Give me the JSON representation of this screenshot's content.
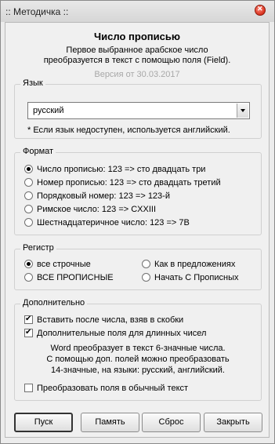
{
  "window": {
    "title": ":: Методичка ::"
  },
  "header": {
    "title": "Число прописью",
    "line1": "Первое выбранное арабское число",
    "line2": "преобразуется в текст с помощью поля (Field).",
    "version": "Версия от 30.03.2017"
  },
  "language": {
    "label": "Язык",
    "selected": "русский",
    "note": "* Если язык недоступен, используется английский."
  },
  "format": {
    "label": "Формат",
    "options": [
      {
        "label": "Число прописью: 123 => сто двадцать три",
        "selected": true
      },
      {
        "label": "Номер прописью: 123 => сто двадцать третий",
        "selected": false
      },
      {
        "label": "Порядковый номер: 123 => 123-й",
        "selected": false
      },
      {
        "label": "Римское число: 123 => CXXIII",
        "selected": false
      },
      {
        "label": "Шестнадцатеричное число: 123 => 7B",
        "selected": false
      }
    ]
  },
  "case": {
    "label": "Регистр",
    "options": [
      {
        "label": "все строчные",
        "selected": true
      },
      {
        "label": "ВСЕ ПРОПИСНЫЕ",
        "selected": false
      },
      {
        "label": "Как в предложениях",
        "selected": false
      },
      {
        "label": "Начать С Прописных",
        "selected": false
      }
    ]
  },
  "extra": {
    "label": "Дополнительно",
    "wrap_brackets": {
      "label": "Вставить после числа, взяв в скобки",
      "checked": true
    },
    "extra_fields": {
      "label": "Дополнительные поля для длинных чисел",
      "checked": true
    },
    "info_lines": [
      "Word преобразует в текст 6-значные числа.",
      "С помощью доп. полей можно преобразовать",
      "14-значные, на языки: русский, английский."
    ],
    "convert_fields": {
      "label": "Преобразовать поля в обычный текст",
      "checked": false
    }
  },
  "buttons": {
    "start": "Пуск",
    "memory": "Память",
    "reset": "Сброс",
    "close": "Закрыть"
  }
}
